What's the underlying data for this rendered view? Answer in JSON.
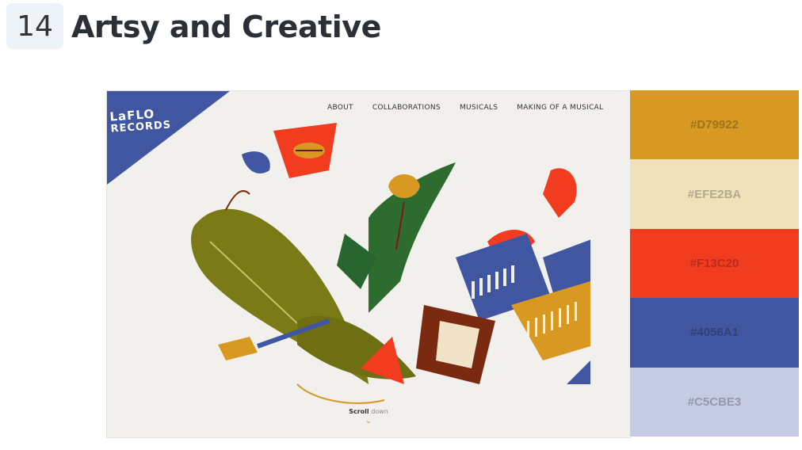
{
  "heading": {
    "number": "14",
    "title": "Artsy and Creative"
  },
  "site": {
    "logo_line1": "LaFLO",
    "logo_line2": "RECORDS",
    "logo_color": "#4056A1",
    "nav": [
      "ABOUT",
      "COLLABORATIONS",
      "MUSICALS",
      "MAKING OF A MUSICAL"
    ],
    "scroll_label_1": "Scroll",
    "scroll_label_2": "down",
    "scroll_icon": "chevron-down-icon"
  },
  "palette": [
    {
      "hex": "#D79922",
      "label": "#D79922"
    },
    {
      "hex": "#EFE2BA",
      "label": "#EFE2BA"
    },
    {
      "hex": "#F13C20",
      "label": "#F13C20"
    },
    {
      "hex": "#4056A1",
      "label": "#4056A1"
    },
    {
      "hex": "#C5CBE3",
      "label": "#C5CBE3"
    }
  ]
}
